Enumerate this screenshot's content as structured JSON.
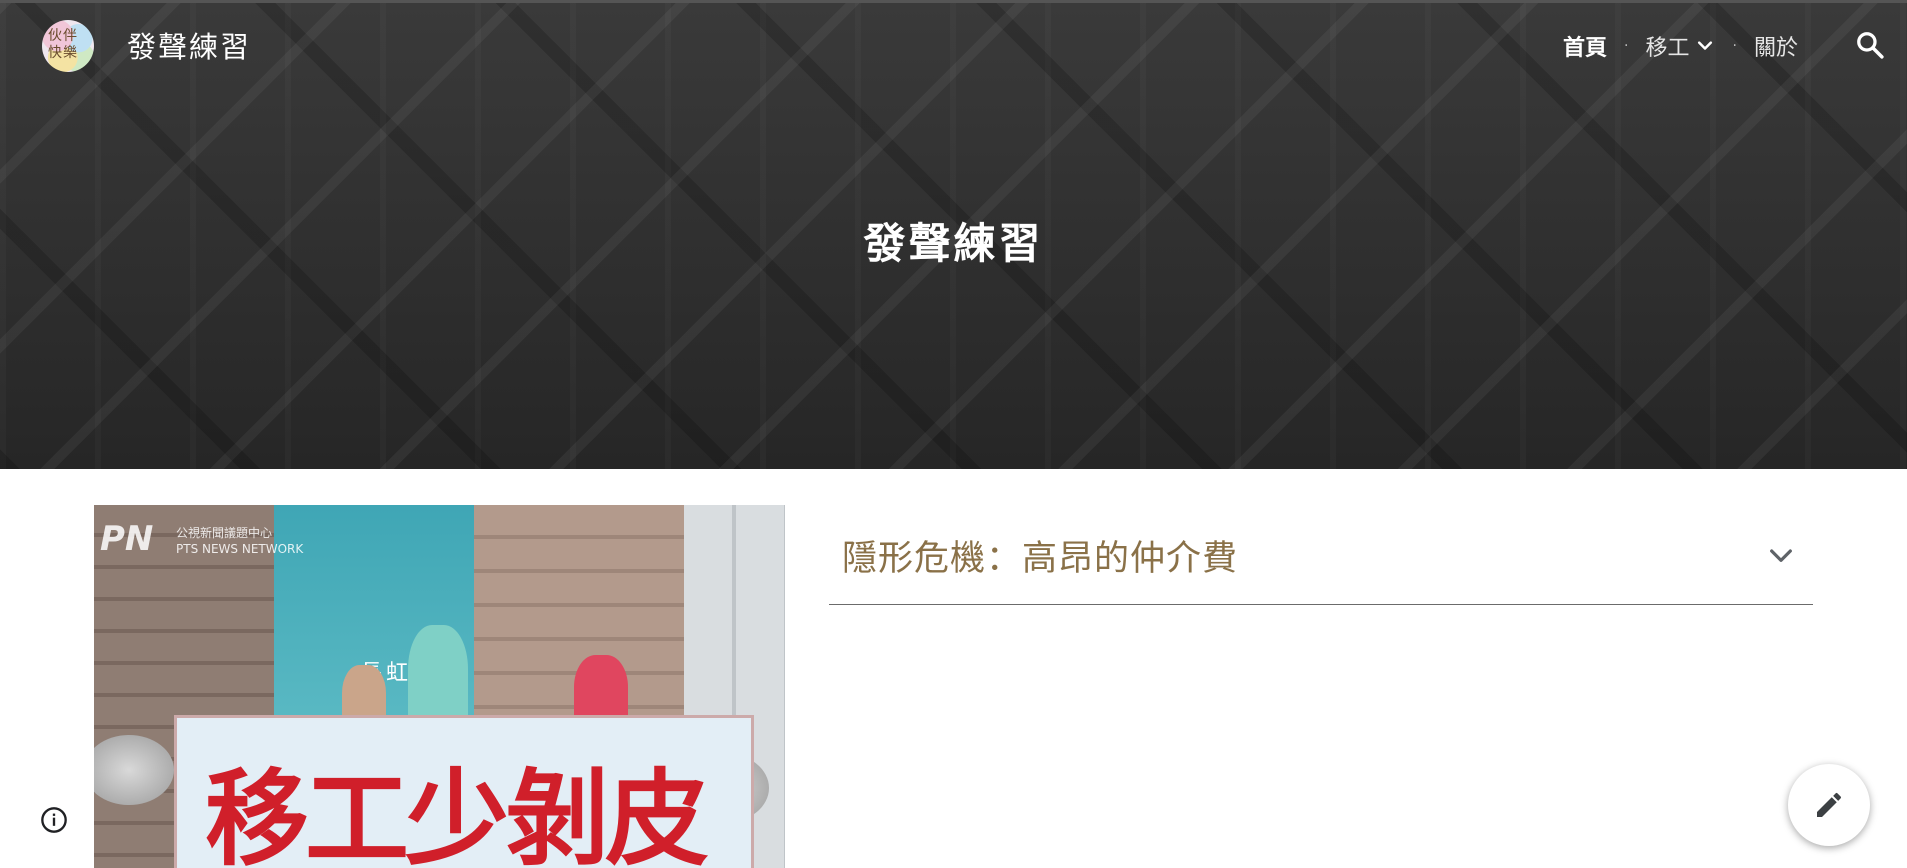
{
  "header": {
    "logo_text": "伙伴\n快樂",
    "site_title": "發聲練習",
    "nav": {
      "home": "首頁",
      "migrant_workers": "移工",
      "about": "關於",
      "separator": "·"
    },
    "icons": {
      "search": "search-icon",
      "dropdown": "chevron-down-icon"
    }
  },
  "hero": {
    "title": "發聲練習"
  },
  "content": {
    "photo": {
      "watermark": "PN",
      "watermark_caption": "公視新聞議題中心\nPTS NEWS NETWORK",
      "building_sign": "長虹",
      "banner_text": "移工少剝皮"
    },
    "collapsible": {
      "title": "隱形危機：高昂的仲介費",
      "icon": "chevron-down-icon"
    }
  },
  "footer": {
    "info_icon": "info-icon",
    "edit_icon": "pencil-icon"
  }
}
